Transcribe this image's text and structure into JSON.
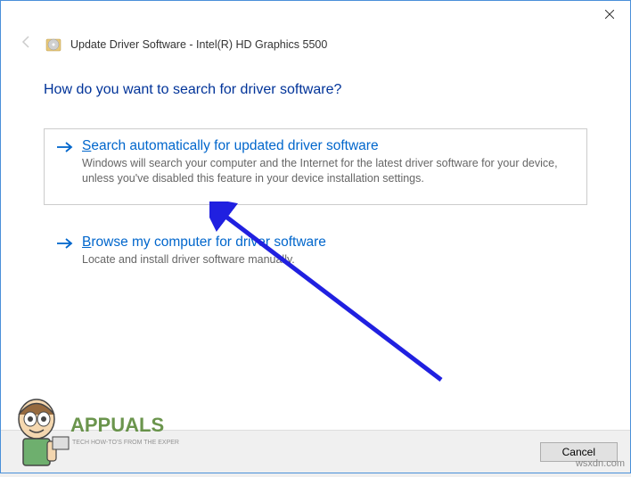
{
  "window": {
    "title": "Update Driver Software - Intel(R) HD Graphics 5500"
  },
  "content": {
    "question": "How do you want to search for driver software?"
  },
  "options": [
    {
      "accelerator": "S",
      "title_rest": "earch automatically for updated driver software",
      "description": "Windows will search your computer and the Internet for the latest driver software for your device, unless you've disabled this feature in your device installation settings."
    },
    {
      "accelerator": "B",
      "title_rest": "rowse my computer for driver software",
      "description": "Locate and install driver software manually."
    }
  ],
  "footer": {
    "cancel_label": "Cancel"
  },
  "watermark": {
    "brand": "APPUALS",
    "tagline": "TECH HOW-TO'S FROM THE EXPERTS!",
    "url": "wsxdn.com"
  }
}
